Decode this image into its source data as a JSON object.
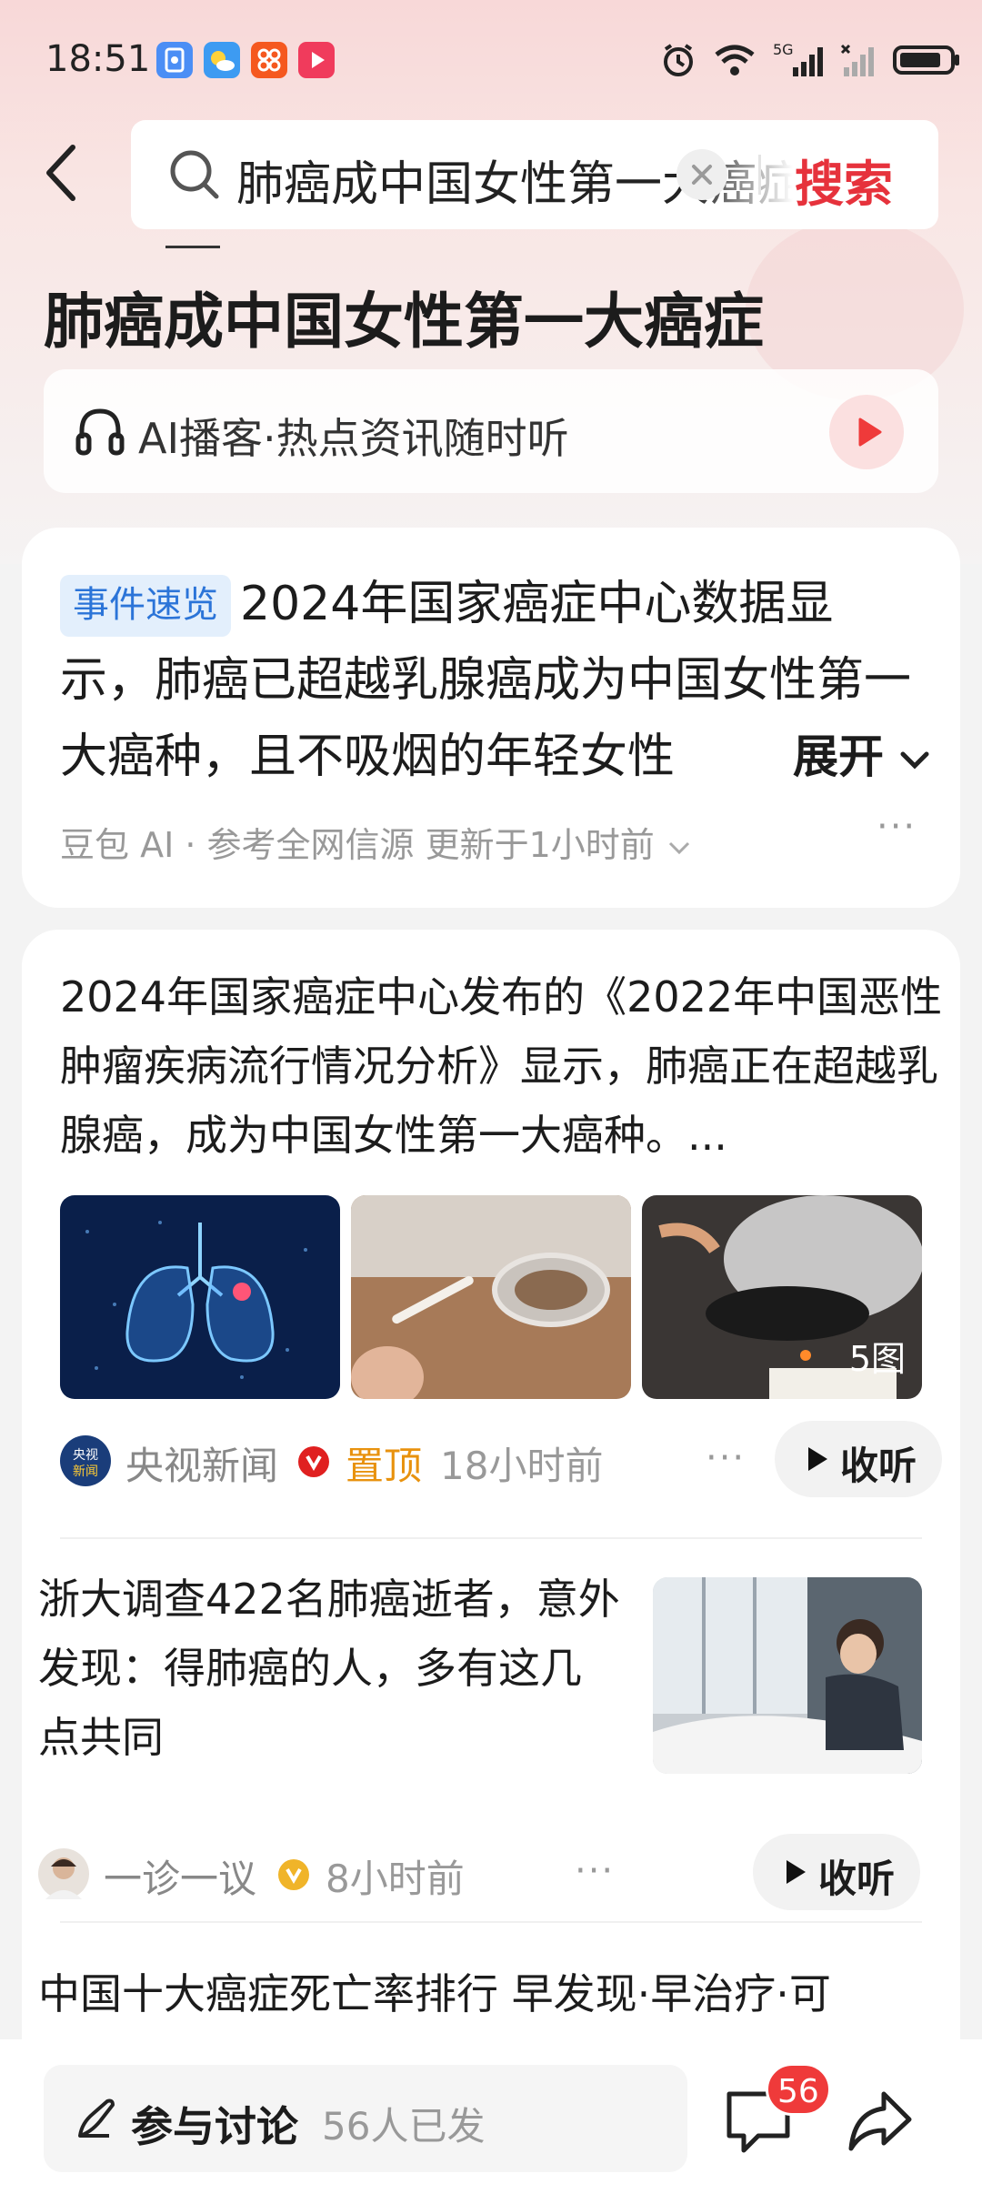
{
  "status_bar": {
    "time": "18:51",
    "network": "5G"
  },
  "search": {
    "query": "肺癌成中国女性第一大癌症",
    "submit_label": "搜索"
  },
  "topic": {
    "title": "肺癌成中国女性第一大癌症",
    "podcast_label": "AI播客·热点资讯随时听"
  },
  "summary": {
    "tag": "事件速览",
    "text": "2024年国家癌症中心数据显示，肺癌已超越乳腺癌成为中国女性第一大癌种，且不吸烟的年轻女性",
    "expand_label": "展开",
    "meta": "豆包 AI · 参考全网信源 更新于1小时前"
  },
  "articles": [
    {
      "text": "2024年国家癌症中心发布的《2022年中国恶性肿瘤疾病流行情况分析》显示，肺癌正在超越乳腺癌，成为中国女性第一大癌种。...",
      "image_count": "5图",
      "source": "央视新闻",
      "source_logo_text": "央视新闻",
      "pinned": "置顶",
      "time": "18小时前",
      "listen_label": "收听"
    },
    {
      "text": "浙大调查422名肺癌逝者，意外发现：得肺癌的人，多有这几点共同",
      "source": "一诊一议",
      "time": "8小时前",
      "listen_label": "收听"
    },
    {
      "text": "中国十大癌症死亡率排行 早发现·早治疗·可"
    }
  ],
  "bottom_bar": {
    "discuss_label": "参与讨论",
    "discuss_count": "56人已发",
    "comment_badge": "56"
  },
  "colors": {
    "accent_red": "#e6323c",
    "tag_blue": "#2b74d8",
    "pin_orange": "#e8920e",
    "verified_red": "#e02020",
    "verified_gold": "#f0b429"
  }
}
